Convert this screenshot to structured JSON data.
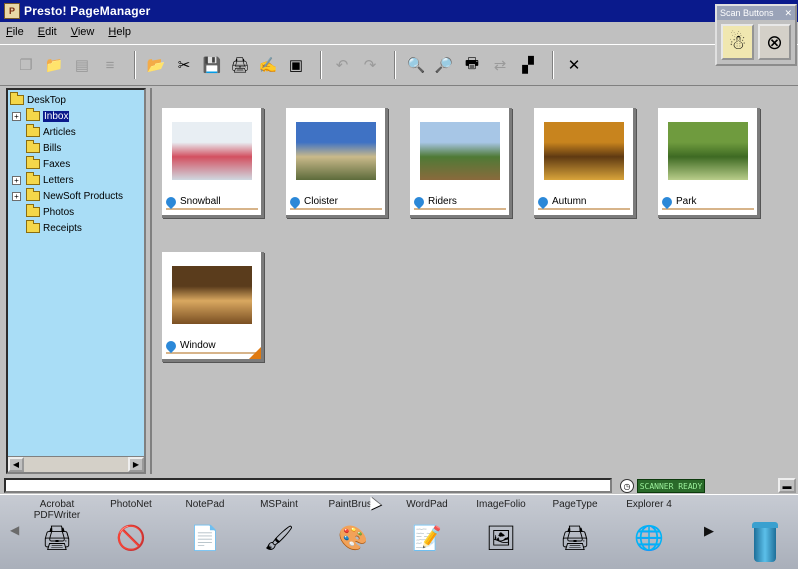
{
  "window": {
    "title": "Presto! PageManager"
  },
  "menu": [
    "File",
    "Edit",
    "View",
    "Help"
  ],
  "toolbar": {
    "buttons": [
      {
        "name": "copy",
        "icon": "copy-icon",
        "glyph": "❐",
        "enabled": false
      },
      {
        "name": "new-folder",
        "icon": "new-folder-icon",
        "glyph": "📁",
        "enabled": false
      },
      {
        "name": "properties",
        "icon": "properties-icon",
        "glyph": "▤",
        "enabled": false
      },
      {
        "name": "rename",
        "icon": "rename-icon",
        "glyph": "≡",
        "enabled": false
      },
      {
        "name": "open",
        "icon": "open-icon",
        "glyph": "📂",
        "enabled": true
      },
      {
        "name": "delete",
        "icon": "delete-icon",
        "glyph": "✂",
        "enabled": true
      },
      {
        "name": "save",
        "icon": "save-icon",
        "glyph": "💾",
        "enabled": true
      },
      {
        "name": "scan",
        "icon": "scan-icon",
        "glyph": "🖨",
        "enabled": true
      },
      {
        "name": "acquire",
        "icon": "acquire-icon",
        "glyph": "✍",
        "enabled": true
      },
      {
        "name": "view",
        "icon": "view-icon",
        "glyph": "▣",
        "enabled": true
      },
      {
        "name": "back",
        "icon": "back-icon",
        "glyph": "↶",
        "enabled": false
      },
      {
        "name": "forward",
        "icon": "forward-icon",
        "glyph": "↷",
        "enabled": false
      },
      {
        "name": "zoom-in",
        "icon": "zoom-in-icon",
        "glyph": "🔍",
        "enabled": true
      },
      {
        "name": "zoom-out",
        "icon": "zoom-out-icon",
        "glyph": "🔎",
        "enabled": true
      },
      {
        "name": "print",
        "icon": "print-icon",
        "glyph": "🖶",
        "enabled": true
      },
      {
        "name": "stitch",
        "icon": "stitch-icon",
        "glyph": "⇄",
        "enabled": false
      },
      {
        "name": "color",
        "icon": "color-icon",
        "glyph": "▞",
        "enabled": true
      },
      {
        "name": "tools",
        "icon": "tools-icon",
        "glyph": "✕",
        "enabled": true
      }
    ]
  },
  "icon_panel": {
    "title": "Scan Buttons"
  },
  "tree": {
    "items": [
      {
        "label": "DeskTop",
        "level": 0,
        "expander": "",
        "selected": false
      },
      {
        "label": "Inbox",
        "level": 1,
        "expander": "+",
        "selected": true
      },
      {
        "label": "Articles",
        "level": 1,
        "expander": "",
        "selected": false
      },
      {
        "label": "Bills",
        "level": 1,
        "expander": "",
        "selected": false
      },
      {
        "label": "Faxes",
        "level": 1,
        "expander": "",
        "selected": false
      },
      {
        "label": "Letters",
        "level": 1,
        "expander": "+",
        "selected": false
      },
      {
        "label": "NewSoft Products",
        "level": 1,
        "expander": "+",
        "selected": false
      },
      {
        "label": "Photos",
        "level": 1,
        "expander": "",
        "selected": false
      },
      {
        "label": "Receipts",
        "level": 1,
        "expander": "",
        "selected": false
      }
    ]
  },
  "thumbnails": [
    {
      "caption": "Snowball",
      "colors": [
        "#e8eef3",
        "#d35060",
        "#cfd8e0"
      ]
    },
    {
      "caption": "Cloister",
      "colors": [
        "#3f72c4",
        "#c9b98a",
        "#5d6b3b"
      ]
    },
    {
      "caption": "Riders",
      "colors": [
        "#a7c6e6",
        "#4f7a36",
        "#8a6a3c"
      ]
    },
    {
      "caption": "Autumn",
      "colors": [
        "#c8841e",
        "#5f3a12",
        "#d9a43a"
      ]
    },
    {
      "caption": "Park",
      "colors": [
        "#6f9b3e",
        "#3e6a23",
        "#b9cd8a"
      ]
    },
    {
      "caption": "Window",
      "colors": [
        "#5a3c1c",
        "#d9a860",
        "#7a4f22"
      ]
    }
  ],
  "status": {
    "meter": "SCANNER READY"
  },
  "launcher": {
    "apps": [
      {
        "label": "Acrobat PDFWriter",
        "icon": "pdf-printer-icon",
        "glyph": "🖨"
      },
      {
        "label": "PhotoNet",
        "icon": "photonet-icon",
        "glyph": "🚫"
      },
      {
        "label": "NotePad",
        "icon": "notepad-icon",
        "glyph": "📄"
      },
      {
        "label": "MSPaint",
        "icon": "mspaint-icon",
        "glyph": "🖌"
      },
      {
        "label": "PaintBrush",
        "icon": "paintbrush-icon",
        "glyph": "🎨"
      },
      {
        "label": "WordPad",
        "icon": "wordpad-icon",
        "glyph": "📝"
      },
      {
        "label": "ImageFolio",
        "icon": "imagefolio-icon",
        "glyph": "🖼"
      },
      {
        "label": "PageType",
        "icon": "pagetype-icon",
        "glyph": "🖨"
      },
      {
        "label": "Explorer 4",
        "icon": "explorer-icon",
        "glyph": "🌐"
      }
    ]
  }
}
